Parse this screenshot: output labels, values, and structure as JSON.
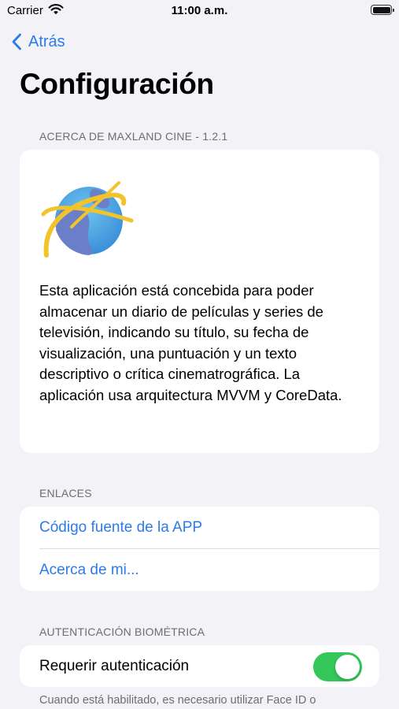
{
  "status_bar": {
    "carrier": "Carrier",
    "time": "11:00 a.m."
  },
  "nav": {
    "back_label": "Atrás",
    "title": "Configuración"
  },
  "about": {
    "header": "ACERCA DE MAXLAND CINE - 1.2.1",
    "description": "Esta aplicación está concebida para poder almacenar un diario de películas y series de televisión, indicando su título, su fecha de visualización, una puntuación y un texto descriptivo o crítica cinematrográfica. La aplicación usa arquitectura MVVM y CoreData."
  },
  "links": {
    "header": "ENLACES",
    "items": [
      {
        "label": "Código fuente de la APP"
      },
      {
        "label": "Acerca de mi..."
      }
    ]
  },
  "auth": {
    "header": "AUTENTICACIÓN BIOMÉTRICA",
    "toggle_label": "Requerir autenticación",
    "toggle_on": true,
    "footer": "Cuando está habilitado, es necesario utilizar Face ID o"
  },
  "colors": {
    "accent": "#2b7be8",
    "toggle_on": "#34c759",
    "background": "#f2f2f7"
  }
}
